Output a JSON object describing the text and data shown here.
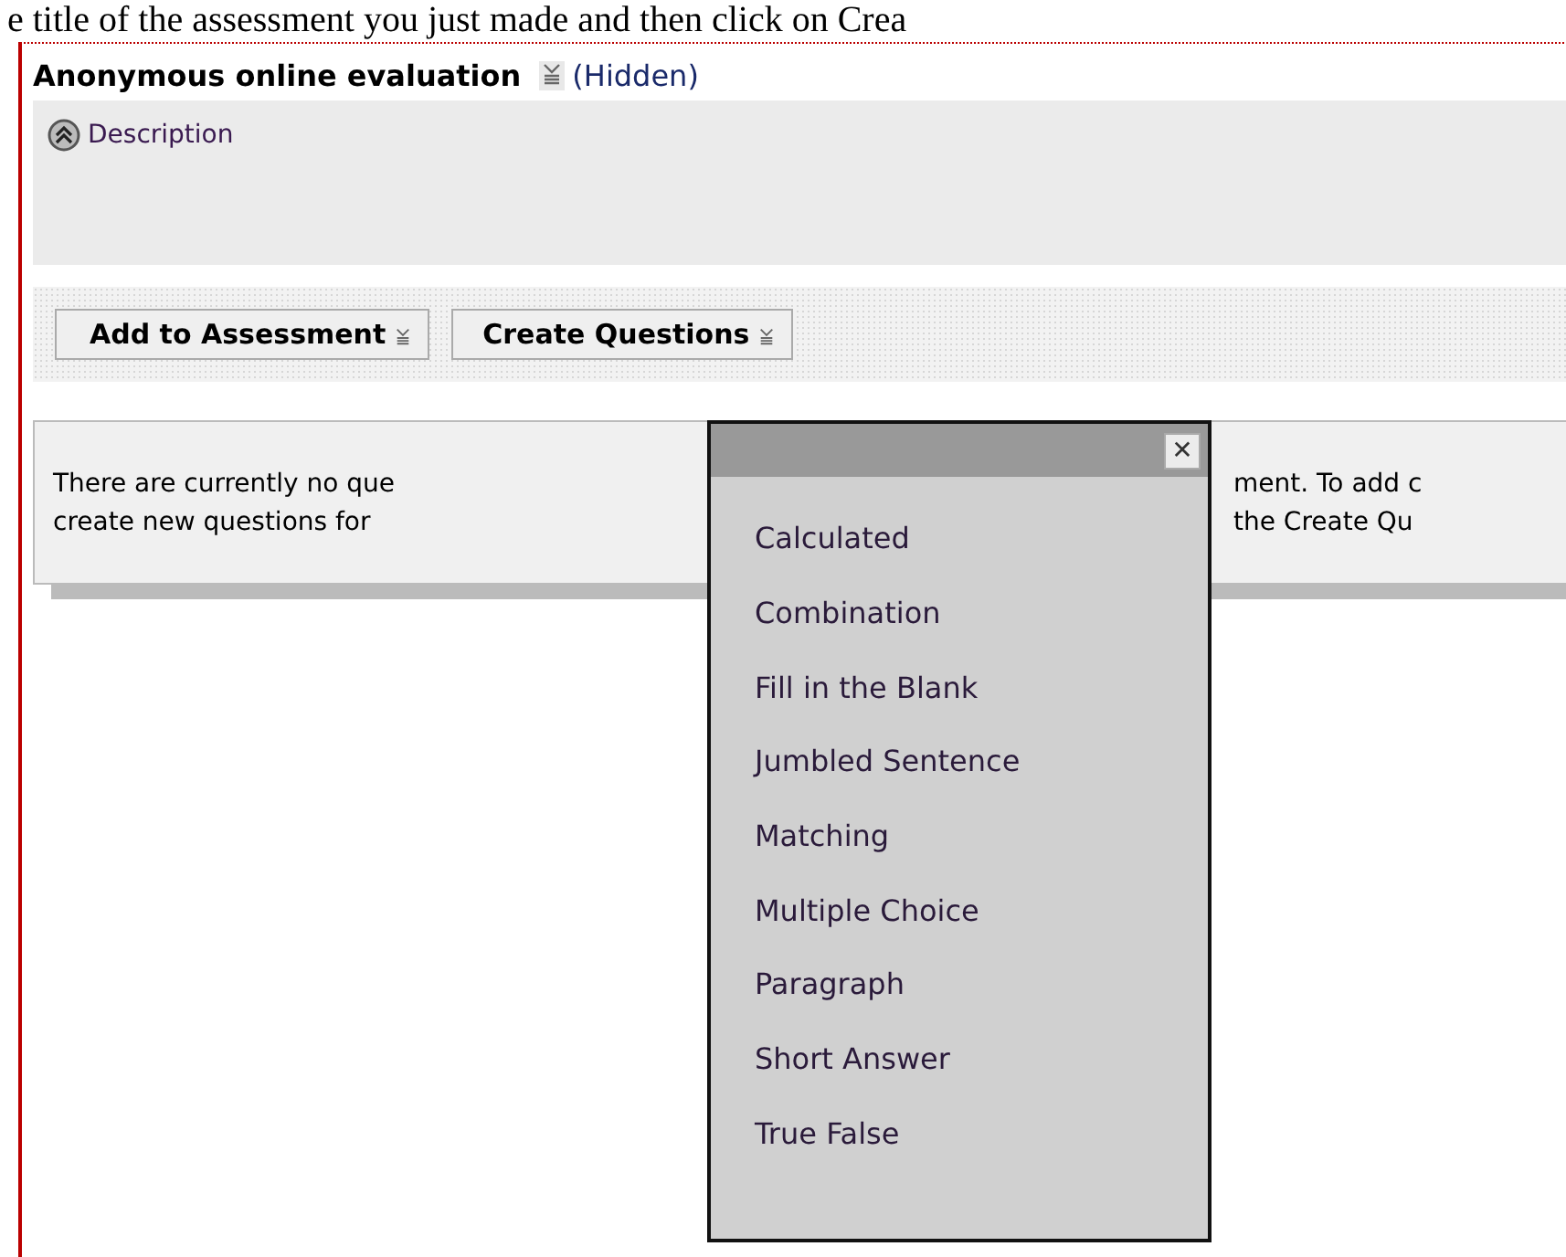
{
  "intro_text": "e title of the assessment you just made and then click on Crea",
  "assessment": {
    "title": "Anonymous online evaluation",
    "visibility": "(Hidden)",
    "description_label": "Description",
    "expanded": true
  },
  "toolbar": {
    "buttons": [
      {
        "label": "Add to Assessment"
      },
      {
        "label": "Create Questions"
      }
    ]
  },
  "message": {
    "lines": [
      {
        "left": "There are currently no que",
        "right": "ment. To add c"
      },
      {
        "left": "create new questions for",
        "right": "the Create Qu"
      }
    ]
  },
  "dropdown": {
    "close_label": "✕",
    "items": [
      "Calculated",
      "Combination",
      "Fill in the Blank",
      "Jumbled Sentence",
      "Matching",
      "Multiple Choice",
      "Paragraph",
      "Short Answer",
      "True False"
    ]
  }
}
